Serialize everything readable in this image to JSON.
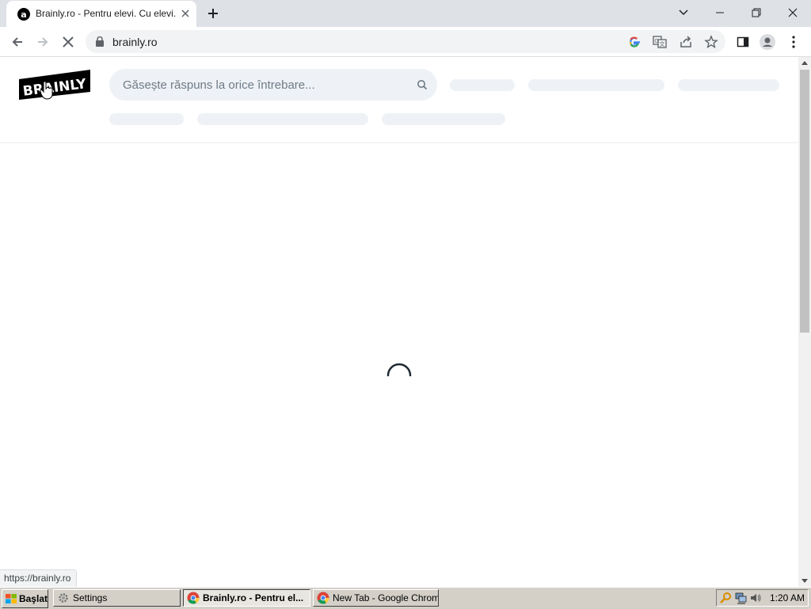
{
  "browser": {
    "tab": {
      "title": "Brainly.ro - Pentru elevi. Cu elevi."
    },
    "address_bar": {
      "url": "brainly.ro"
    },
    "status_url": "https://brainly.ro"
  },
  "site": {
    "logo_text": "BRAINLY",
    "search": {
      "placeholder": "Găsește răspuns la orice întrebare..."
    },
    "loading": true
  },
  "taskbar": {
    "start_label": "Başlat",
    "buttons": [
      {
        "label": "Settings",
        "icon": "gear-icon"
      },
      {
        "label": "Brainly.ro - Pentru el...",
        "icon": "chrome-icon",
        "active": true
      },
      {
        "label": "New Tab - Google Chrome",
        "icon": "chrome-icon"
      }
    ],
    "clock": "1:20 AM"
  },
  "colors": {
    "tabstrip": "#dee1e6",
    "skeleton": "#eef2f6",
    "taskbar": "#d4d0c8"
  }
}
